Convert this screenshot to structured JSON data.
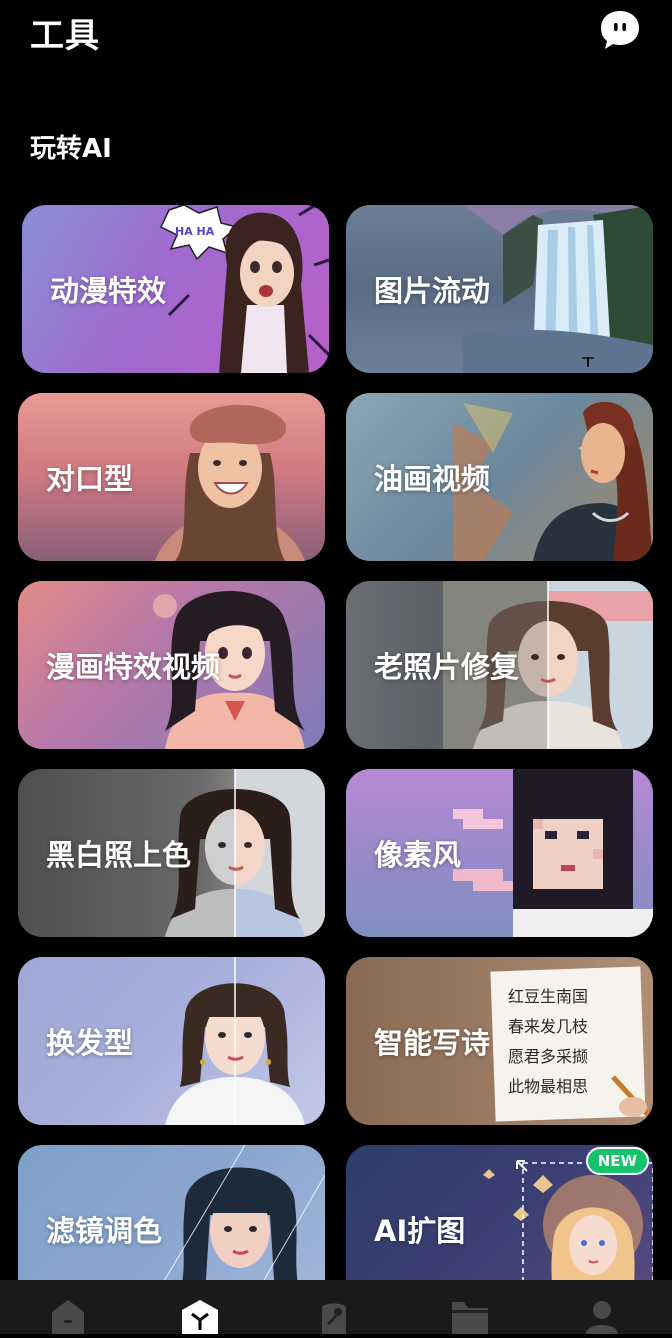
{
  "header": {
    "title": "工具"
  },
  "section": {
    "title": "玩转AI"
  },
  "cards": [
    {
      "label": "动漫特效",
      "art": "anime-girl-haha-art",
      "bubble": "HA HA"
    },
    {
      "label": "图片流动",
      "art": "waterfall-art"
    },
    {
      "label": "对口型",
      "art": "smiling-woman-beret-art"
    },
    {
      "label": "油画视频",
      "art": "oil-painting-woman-art"
    },
    {
      "label": "漫画特效视频",
      "art": "comic-girl-art"
    },
    {
      "label": "老照片修复",
      "art": "photo-restore-art"
    },
    {
      "label": "黑白照上色",
      "art": "bw-colorize-art"
    },
    {
      "label": "像素风",
      "art": "pixel-girl-art"
    },
    {
      "label": "换发型",
      "art": "hairstyle-split-art"
    },
    {
      "label": "智能写诗",
      "art": "poem-paper-art",
      "poem": [
        "红豆生南国",
        "春来发几枝",
        "愿君多采撷",
        "此物最相思"
      ]
    },
    {
      "label": "滤镜调色",
      "art": "filter-girl-art"
    },
    {
      "label": "AI扩图",
      "art": "expand-image-art",
      "badge": "NEW"
    }
  ],
  "tabbar": {
    "items": [
      {
        "icon": "home-icon"
      },
      {
        "icon": "tools-icon",
        "active": true
      },
      {
        "icon": "brush-icon"
      },
      {
        "icon": "folder-icon"
      },
      {
        "icon": "profile-icon"
      }
    ]
  }
}
